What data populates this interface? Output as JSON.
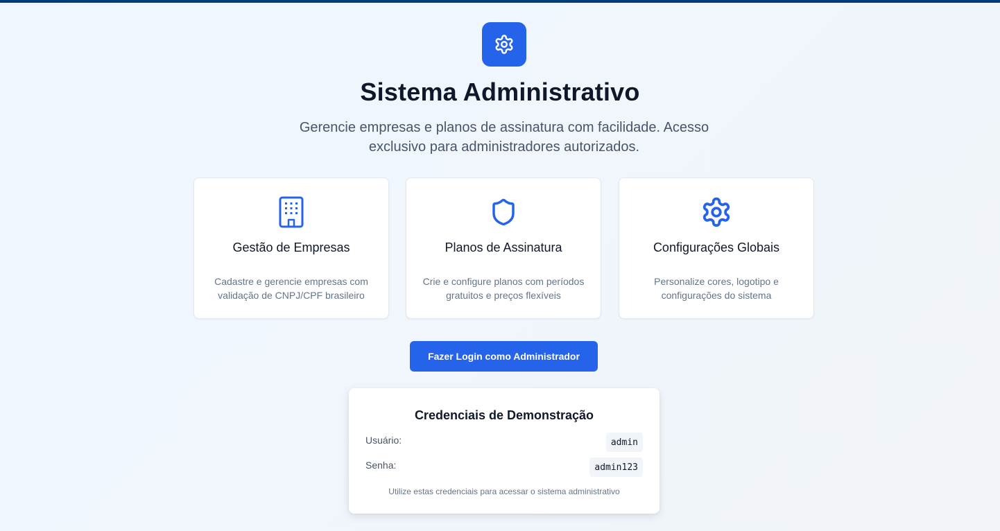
{
  "colors": {
    "top_bar": "#003b7a",
    "accent": "#2563eb",
    "background": "#eff6ff"
  },
  "hero": {
    "icon": "gear-icon",
    "title": "Sistema Administrativo",
    "subtitle": "Gerencie empresas e planos de assinatura com facilidade. Acesso exclusivo para administradores autorizados."
  },
  "features": [
    {
      "icon": "building-icon",
      "title": "Gestão de Empresas",
      "description": "Cadastre e gerencie empresas com validação de CNPJ/CPF brasileiro"
    },
    {
      "icon": "shield-icon",
      "title": "Planos de Assinatura",
      "description": "Crie e configure planos com períodos gratuitos e preços flexíveis"
    },
    {
      "icon": "gear-icon",
      "title": "Configurações Globais",
      "description": "Personalize cores, logotipo e configurações do sistema"
    }
  ],
  "login_button": "Fazer Login como Administrador",
  "credentials": {
    "title": "Credenciais de Demonstração",
    "user_label": "Usuário:",
    "user_value": "admin",
    "password_label": "Senha:",
    "password_value": "admin123",
    "note": "Utilize estas credenciais para acessar o sistema administrativo"
  }
}
